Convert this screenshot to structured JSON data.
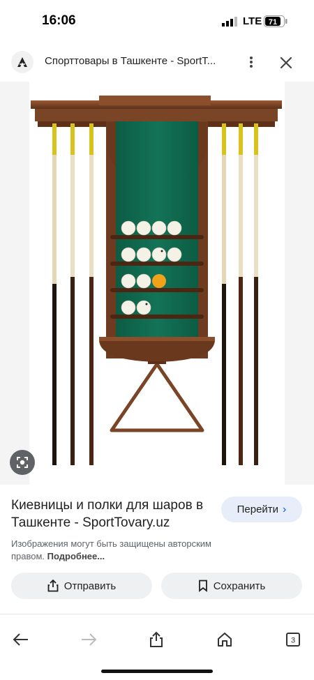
{
  "status": {
    "time": "16:06",
    "network": "LTE",
    "battery": "71"
  },
  "header": {
    "site_title": "Спорттовары в Ташкенте - SportT...",
    "favicon": "site-logo-icon",
    "more": "more-vert-icon",
    "close": "close-icon"
  },
  "image": {
    "description_icon": "lens-search-icon"
  },
  "info": {
    "title": "Киевницы и полки для шаров в Ташкенте - SportTovary.uz",
    "visit_label": "Перейти",
    "copyright_text": "Изображения могут быть защищены авторским правом.",
    "more_label": "Подробнее..."
  },
  "actions": {
    "share_label": "Отправить",
    "save_label": "Сохранить"
  },
  "nav": {
    "tabs_count": "3"
  },
  "colors": {
    "felt": "#0f6a4e",
    "wood": "#7a4526",
    "accent": "#0b57d0",
    "chip": "#e8eef9"
  }
}
